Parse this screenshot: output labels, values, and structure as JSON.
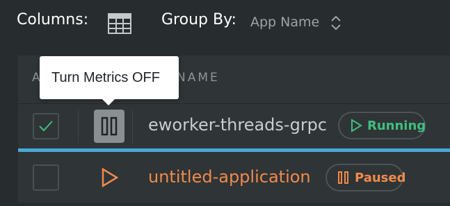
{
  "toolbar": {
    "columns_label": "Columns:",
    "columns_icon": "table-icon",
    "group_by_label": "Group By:",
    "group_by_value": "App Name",
    "group_by_icon": "chevron-up-down-icon"
  },
  "table": {
    "headers": [
      "A",
      "NAME"
    ],
    "rows": [
      {
        "checked": true,
        "action_icon": "pause-icon",
        "app_name": "eworker-threads-grpc",
        "status": "Running",
        "status_icon": "play-outline-icon",
        "status_color": "#3fbf7f"
      },
      {
        "checked": false,
        "action_icon": "play-icon",
        "app_name": "untitled-application",
        "status": "Paused",
        "status_icon": "pause-outline-icon",
        "status_color": "#f08a4b"
      }
    ]
  },
  "tooltip": {
    "text": "Turn Metrics OFF"
  },
  "colors": {
    "background": "#272c2e",
    "table_bg": "#2f3436",
    "selection_accent": "#4aa8d8",
    "running": "#3fbf7f",
    "paused": "#f08a4b"
  }
}
